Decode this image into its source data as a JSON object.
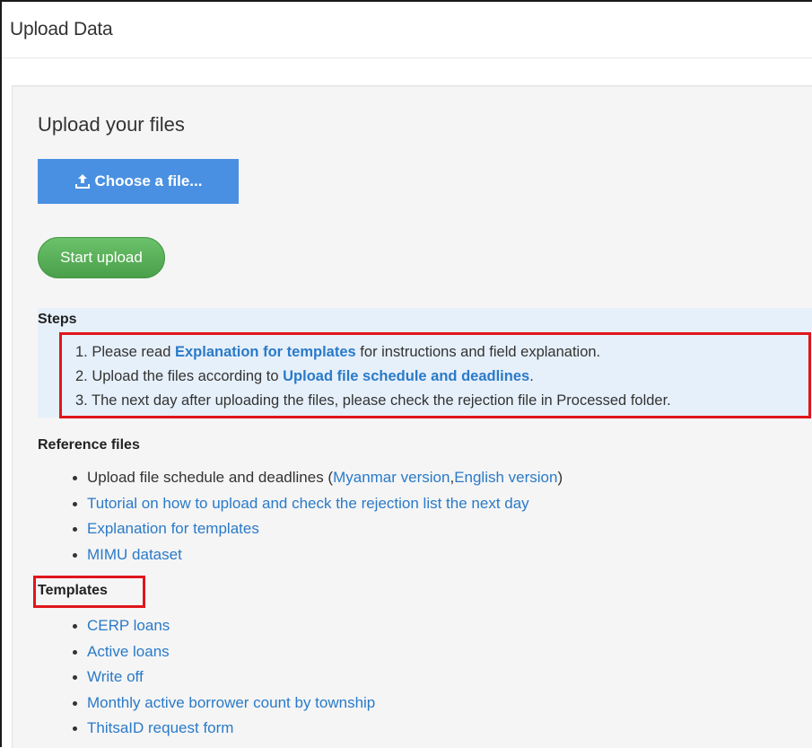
{
  "header": {
    "title": "Upload Data"
  },
  "upload": {
    "heading": "Upload your files",
    "choose_label": "Choose a file...",
    "start_label": "Start upload"
  },
  "steps": {
    "heading": "Steps",
    "items": [
      {
        "prefix": "1. Please read ",
        "link": "Explanation for templates",
        "suffix": " for instructions and field explanation."
      },
      {
        "prefix": "2. Upload the files according to ",
        "link": "Upload file schedule and deadlines",
        "suffix": "."
      },
      {
        "text": "3. The next day after uploading the files, please check the rejection file in Processed folder."
      }
    ]
  },
  "reference": {
    "heading": "Reference files",
    "schedule_text": "Upload file schedule and deadlines (",
    "myanmar_link": "Myanmar version",
    "comma": ",",
    "english_link": "English version",
    "close_paren": ")",
    "tutorial_link": "Tutorial on how to upload and check the rejection list the next day",
    "explanation_link": "Explanation for templates",
    "mimu_link": "MIMU dataset"
  },
  "templates": {
    "heading": "Templates",
    "items": [
      "CERP loans",
      "Active loans",
      "Write off",
      "Monthly active borrower count by township",
      "ThitsaID request form"
    ]
  },
  "colors": {
    "primary_button": "#4a90e2",
    "success_button": "#5cb85c",
    "link": "#2a7ac8",
    "highlight_border": "#e0161b",
    "steps_background": "#e6f0fa"
  },
  "icons": {
    "choose_button_icon": "upload-icon"
  }
}
